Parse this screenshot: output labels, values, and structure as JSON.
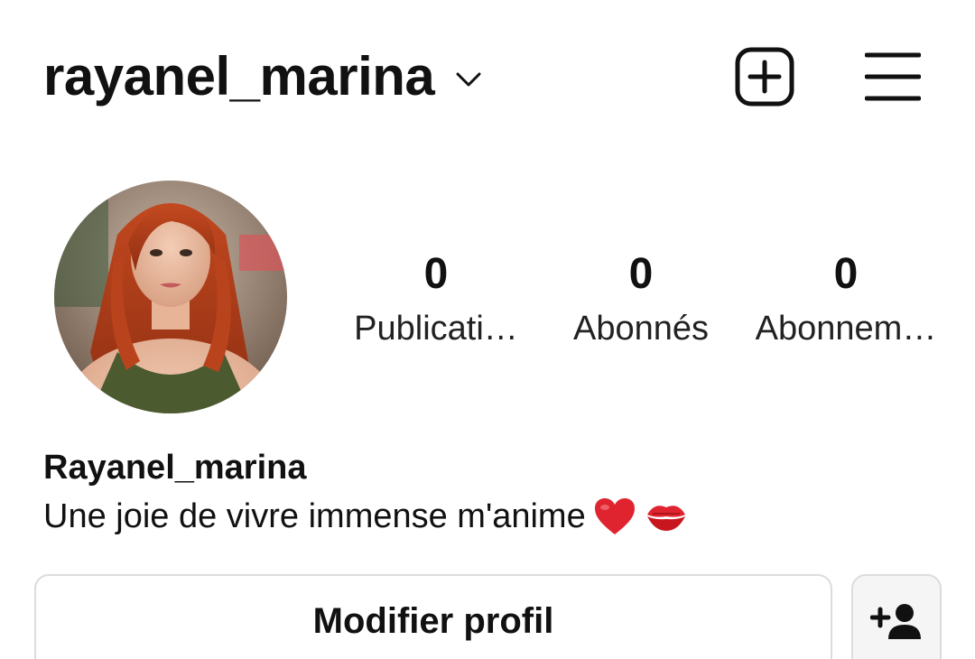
{
  "header": {
    "username": "rayanel_marina",
    "icons": {
      "switch_account": "chevron-down-icon",
      "create": "plus-square-icon",
      "menu": "hamburger-menu-icon"
    }
  },
  "profile": {
    "avatar": "profile-photo",
    "stats": [
      {
        "count": "0",
        "label": "Publicati…"
      },
      {
        "count": "0",
        "label": "Abonnés"
      },
      {
        "count": "0",
        "label": "Abonnem…"
      }
    ]
  },
  "bio": {
    "name": "Rayanel_marina",
    "text": "Une joie de vivre immense m'anime",
    "emojis": [
      "red-heart",
      "kiss-mark"
    ]
  },
  "actions": {
    "edit_profile_label": "Modifier profil",
    "add_user_icon": "add-user-icon"
  },
  "colors": {
    "text": "#111111",
    "button_border": "#dcdcdc",
    "button_bg_secondary": "#f5f5f5",
    "heart": "#e0242f",
    "background": "#ffffff"
  }
}
